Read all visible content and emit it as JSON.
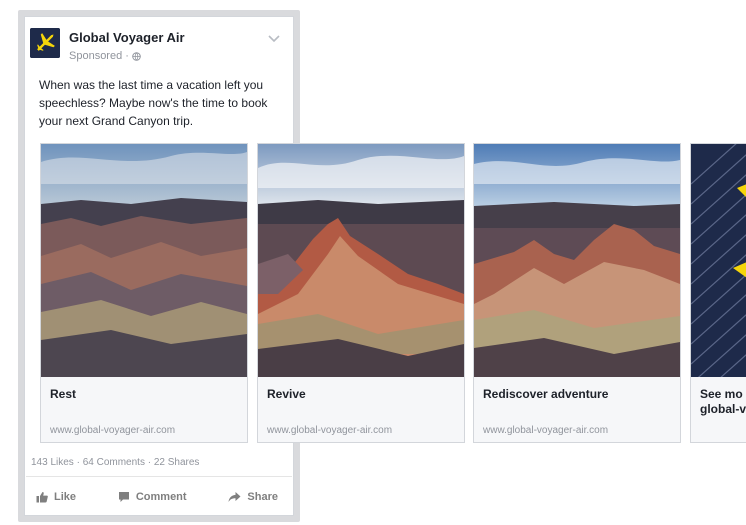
{
  "post": {
    "page_name": "Global Voyager Air",
    "sponsored_label": "Sponsored",
    "text": "When was the last time a vacation left you speechless? Maybe now's the time to book your next Grand Canyon trip.",
    "stats": "143 Likes · 64 Comments · 22 Shares"
  },
  "carousel": {
    "cards": [
      {
        "title": "Rest",
        "url": "www.global-voyager-air.com"
      },
      {
        "title": "Revive",
        "url": "www.global-voyager-air.com"
      },
      {
        "title": "Rediscover adventure",
        "url": "www.global-voyager-air.com"
      },
      {
        "title_line1": "See mo",
        "title_line2": "global-v"
      }
    ]
  },
  "actions": {
    "like": "Like",
    "comment": "Comment",
    "share": "Share"
  },
  "icons": {
    "avatar": "airplane-icon",
    "audience": "globe-icon",
    "menu": "chevron-down-icon",
    "like": "thumbs-up-icon",
    "comment": "comment-icon",
    "share": "share-arrow-icon"
  },
  "colors": {
    "brand_navy": "#1e2a4a",
    "brand_yellow": "#f5d50a",
    "muted_text": "#90949c",
    "card_background": "#f6f7f9"
  }
}
